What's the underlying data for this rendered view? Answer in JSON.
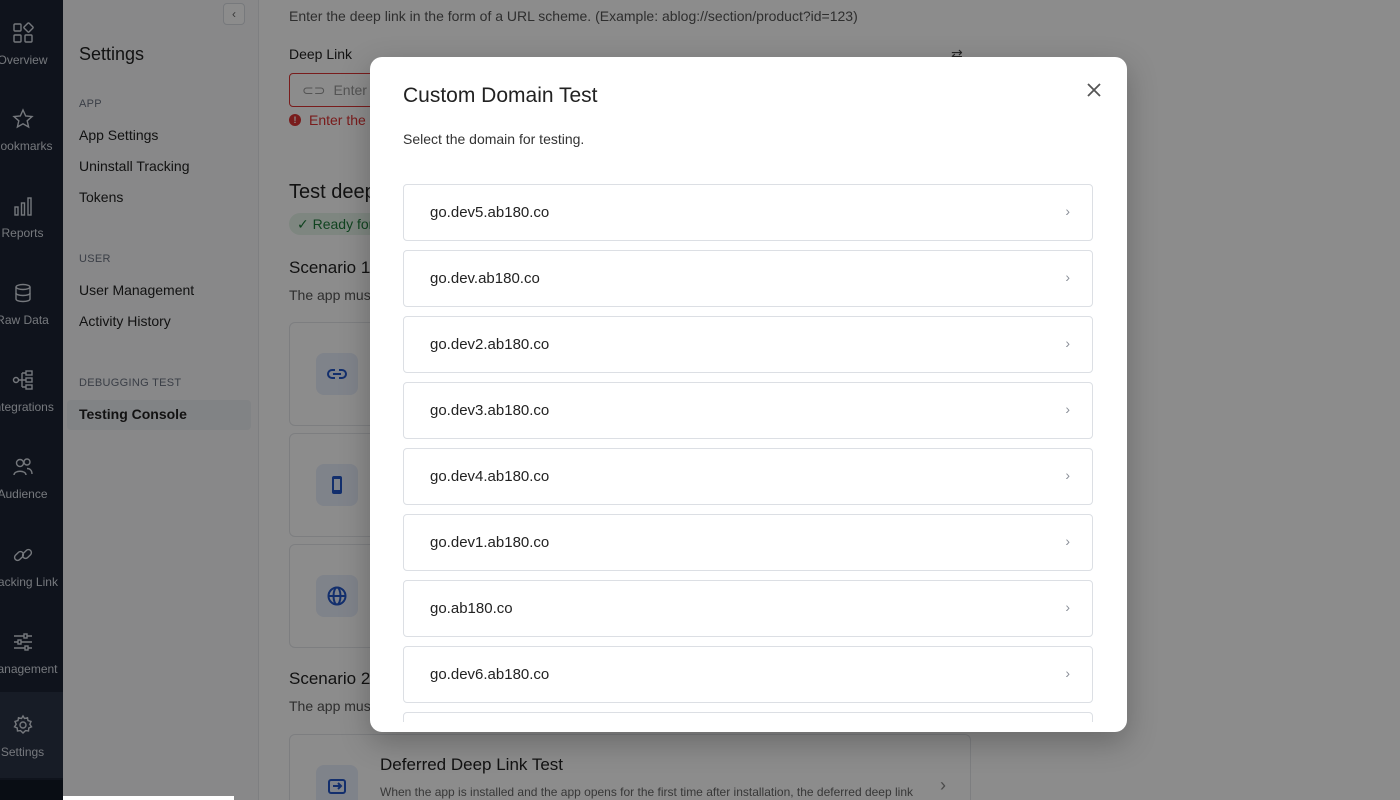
{
  "rail": {
    "items": [
      {
        "label": "Overview",
        "icon": "overview-icon"
      },
      {
        "label": "Bookmarks",
        "icon": "star-icon"
      },
      {
        "label": "Reports",
        "icon": "bar-chart-icon"
      },
      {
        "label": "Raw Data",
        "icon": "database-icon"
      },
      {
        "label": "Integrations",
        "icon": "integrations-icon"
      },
      {
        "label": "Audience",
        "icon": "people-icon"
      },
      {
        "label": "Tracking Link",
        "icon": "link-icon"
      },
      {
        "label": "Management",
        "icon": "sliders-icon"
      },
      {
        "label": "Settings",
        "icon": "gear-icon"
      }
    ],
    "active": "Settings"
  },
  "settings_sidebar": {
    "collapse_glyph": "‹",
    "title": "Settings",
    "sections": [
      {
        "label": "APP",
        "links": [
          "App Settings",
          "Uninstall Tracking",
          "Tokens"
        ]
      },
      {
        "label": "USER",
        "links": [
          "User Management",
          "Activity History"
        ]
      },
      {
        "label": "DEBUGGING TEST",
        "links": [
          "Testing Console"
        ]
      }
    ],
    "active_link": "Testing Console"
  },
  "main": {
    "description": "Enter the deep link in the form of a URL scheme. (Example: ablog://section/product?id=123)",
    "deep_link_label": "Deep Link",
    "deep_link_placeholder": "Enter d",
    "error_text": "Enter the",
    "test_heading": "Test deep",
    "ready_badge": "Ready for",
    "scenario1_title": "Scenario 1",
    "scenario1_desc": "The app mus",
    "scenario2_title": "Scenario 2",
    "scenario2_desc": "The app mus",
    "deferred_card_title": "Deferred Deep Link Test",
    "deferred_card_desc": "When the app is installed and the app opens for the first time after installation, the deferred deep link"
  },
  "modal": {
    "title": "Custom Domain Test",
    "subtitle": "Select the domain for testing.",
    "domains": [
      "go.dev5.ab180.co",
      "go.dev.ab180.co",
      "go.dev2.ab180.co",
      "go.dev3.ab180.co",
      "go.dev4.ab180.co",
      "go.dev1.ab180.co",
      "go.ab180.co",
      "go.dev6.ab180.co"
    ]
  },
  "colors": {
    "rail_bg": "#1d2433",
    "error": "#dd3333",
    "accent": "#2456c7",
    "success": "#1e7b3a"
  }
}
